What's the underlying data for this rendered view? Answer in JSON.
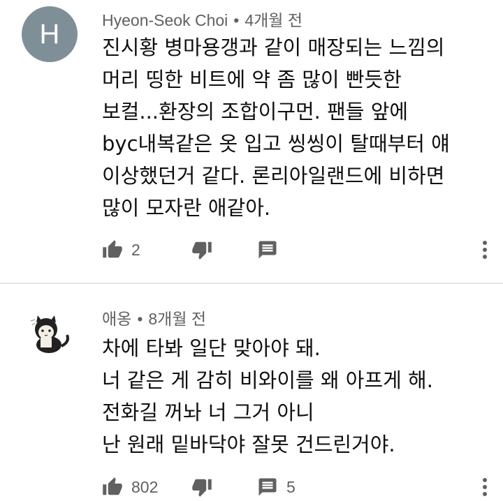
{
  "comments": [
    {
      "avatar_letter": "H",
      "author": "Hyeon-Seok Choi",
      "time": "4개월 전",
      "lines": [
        "진시황 병마용갱과 같이 매장되는 느낌의",
        "머리 띵한 비트에 약 좀 많이 빤듯한",
        "보컬...환장의 조합이구먼. 팬들 앞에",
        "byc내복같은 옷 입고 씽씽이 탈때부터 얘",
        "이상했던거 같다. 론리아일랜드에 비하면",
        "많이 모자란 애같아."
      ],
      "likes": "2",
      "replies": ""
    },
    {
      "author": "애옹",
      "time": "8개월 전",
      "lines": [
        "차에 타봐 일단 맞아야 돼.",
        "너 같은 게 감히 비와이를 왜 아프게 해.",
        "전화길 꺼놔 너 그거 아니",
        "난 원래 밑바닥야 잘못 건드린거야."
      ],
      "likes": "802",
      "replies": "5"
    }
  ],
  "colors": {
    "meta": "#606060",
    "text": "#0f0f0f",
    "avatar_bg": "#7f8f98",
    "divider": "#e5e5e5"
  },
  "icons": {
    "like": "thumbs-up-icon",
    "dislike": "thumbs-down-icon",
    "reply": "reply-icon",
    "more": "more-vert-icon"
  }
}
